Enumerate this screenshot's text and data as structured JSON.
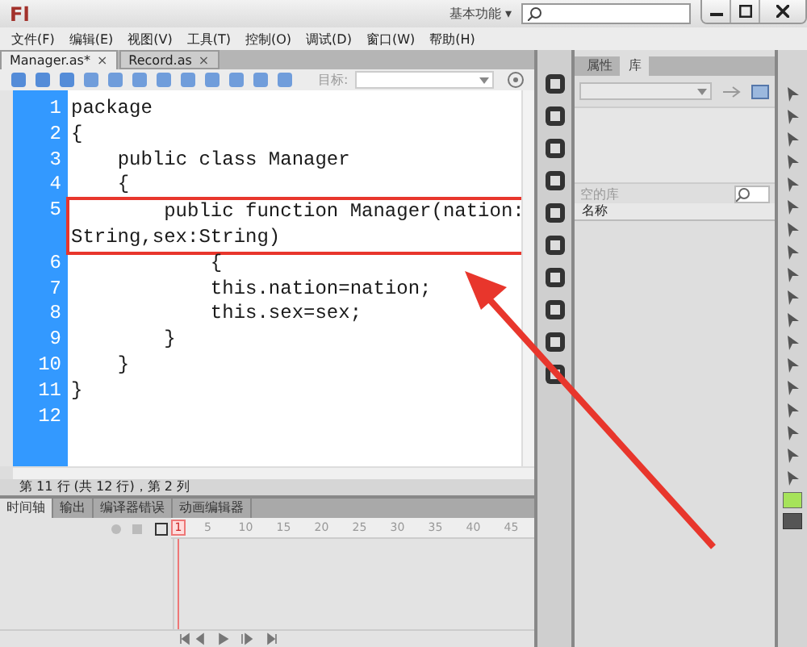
{
  "app": {
    "logo": "Fl",
    "workspace": "基本功能",
    "workspace_caret": "▾"
  },
  "menu": [
    "文件(F)",
    "编辑(E)",
    "视图(V)",
    "工具(T)",
    "控制(O)",
    "调试(D)",
    "窗口(W)",
    "帮助(H)"
  ],
  "documents": [
    {
      "label": "Manager.as*",
      "close": "×",
      "selected": true
    },
    {
      "label": "Record.as",
      "close": "×",
      "selected": false
    }
  ],
  "toolbar": {
    "target_label": "目标:"
  },
  "code": {
    "lines": [
      {
        "number": "1",
        "text": "package",
        "highlighted": false
      },
      {
        "number": "2",
        "text": "{",
        "highlighted": false
      },
      {
        "number": "3",
        "text": "    public class Manager",
        "highlighted": false
      },
      {
        "number": "4",
        "text": "    {",
        "highlighted": false
      },
      {
        "number": "5",
        "text": "        public function Manager(nation:String,sex:String)",
        "highlighted": true
      },
      {
        "number": "6",
        "text": "            {",
        "highlighted": false
      },
      {
        "number": "7",
        "text": "            this.nation=nation;",
        "highlighted": false
      },
      {
        "number": "8",
        "text": "            this.sex=sex;",
        "highlighted": false
      },
      {
        "number": "9",
        "text": "        }",
        "highlighted": false
      },
      {
        "number": "10",
        "text": "    }",
        "highlighted": false
      },
      {
        "number": "11",
        "text": "}",
        "highlighted": false
      },
      {
        "number": "12",
        "highlighted": false
      }
    ]
  },
  "status_bar": "第 11 行 (共 12 行)，第 2 列",
  "bottom_tabs": [
    {
      "label": "时间轴",
      "selected": true
    },
    {
      "label": "输出",
      "selected": false
    },
    {
      "label": "编译器错误",
      "selected": false
    },
    {
      "label": "动画编辑器",
      "selected": false
    }
  ],
  "timeline": {
    "ruler": [
      "1",
      "5",
      "10",
      "15",
      "20",
      "25",
      "30",
      "35",
      "40",
      "45"
    ]
  },
  "panel": {
    "tabs": [
      {
        "label": "属性",
        "selected": false
      },
      {
        "label": "库",
        "selected": true
      }
    ],
    "library_label": "空的库",
    "column": "名称"
  }
}
